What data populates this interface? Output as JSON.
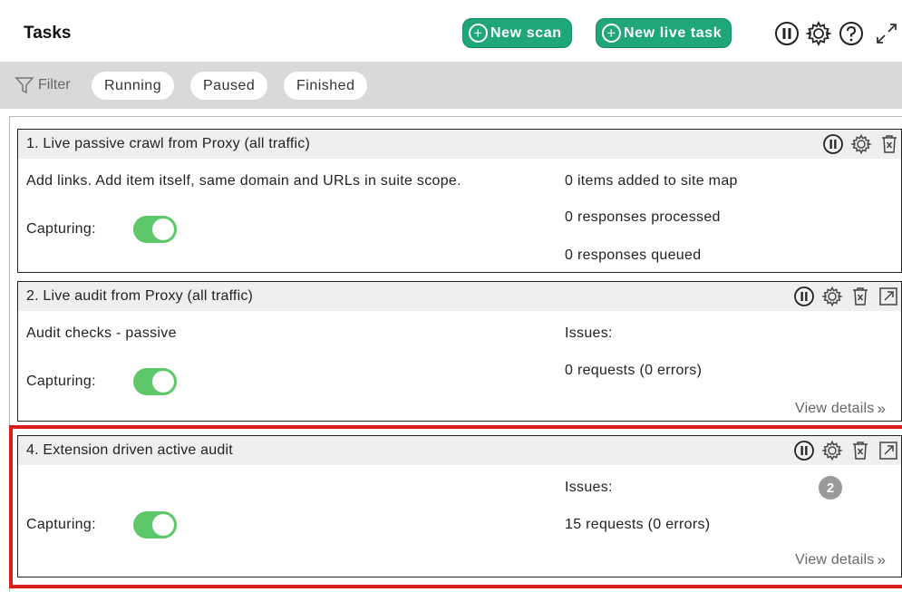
{
  "header": {
    "title": "Tasks",
    "new_scan_label": "New scan",
    "new_live_task_label": "New live task",
    "accent_color": "#1fa67a"
  },
  "filter": {
    "label": "Filter",
    "pills": [
      "Running",
      "Paused",
      "Finished"
    ]
  },
  "tasks": [
    {
      "title": "1. Live passive crawl from Proxy (all traffic)",
      "description": "Add links. Add item itself, same domain and URLs in suite scope.",
      "capturing_label": "Capturing:",
      "capturing_on": true,
      "stats": [
        "0 items added to site map",
        "0 responses processed",
        "0 responses queued"
      ]
    },
    {
      "title": "2. Live audit from Proxy (all traffic)",
      "description": "Audit checks - passive",
      "capturing_label": "Capturing:",
      "capturing_on": true,
      "issues_label": "Issues:",
      "requests": "0 requests (0 errors)",
      "view_details": "View details"
    },
    {
      "title": "4. Extension driven active audit",
      "description": "",
      "capturing_label": "Capturing:",
      "capturing_on": true,
      "issues_label": "Issues:",
      "issues_count": "2",
      "requests": "15 requests (0 errors)",
      "view_details": "View details",
      "highlighted": true
    }
  ],
  "icons": {
    "header": [
      "pause-icon",
      "gear-icon",
      "help-icon",
      "expand-icon"
    ],
    "task": [
      "pause-icon",
      "gear-icon",
      "trash-icon",
      "popout-icon"
    ]
  },
  "colors": {
    "toggle_on": "#5cc86a",
    "highlight": "#e01b1b",
    "badge": "#9a9a9a"
  }
}
